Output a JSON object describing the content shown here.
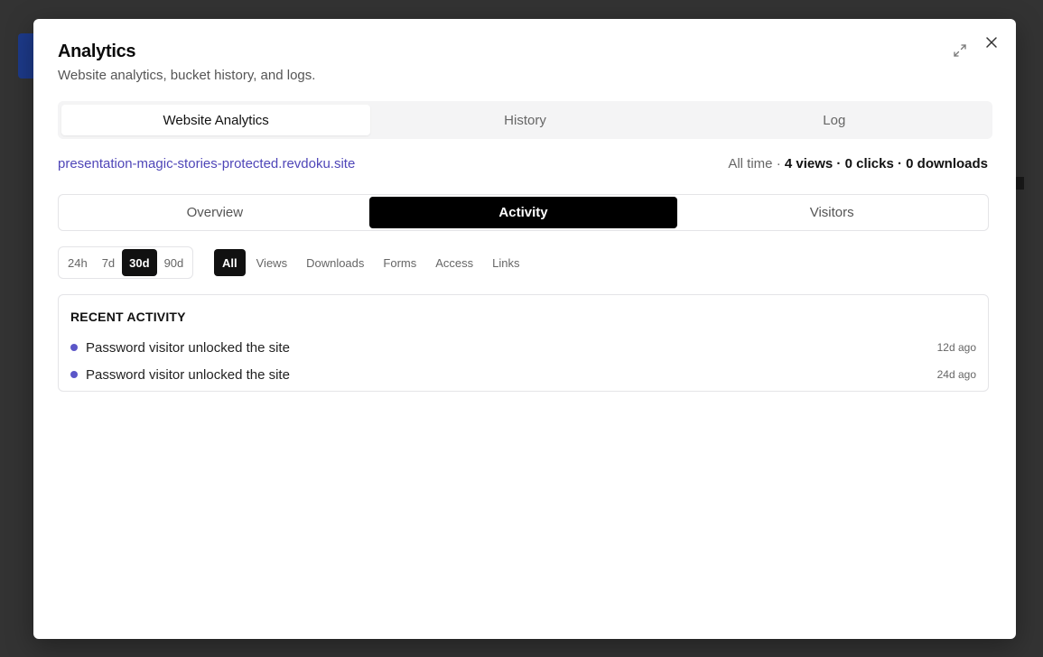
{
  "modal": {
    "title": "Analytics",
    "subtitle": "Website analytics, bucket history, and logs."
  },
  "main_tabs": [
    {
      "label": "Website Analytics",
      "active": true
    },
    {
      "label": "History",
      "active": false
    },
    {
      "label": "Log",
      "active": false
    }
  ],
  "site": {
    "url": "presentation-magic-stories-protected.revdoku.site"
  },
  "stats": {
    "period": "All time",
    "views": "4 views",
    "clicks": "0 clicks",
    "downloads": "0 downloads"
  },
  "sub_tabs": [
    {
      "label": "Overview",
      "active": false
    },
    {
      "label": "Activity",
      "active": true
    },
    {
      "label": "Visitors",
      "active": false
    }
  ],
  "ranges": [
    {
      "label": "24h",
      "active": false
    },
    {
      "label": "7d",
      "active": false
    },
    {
      "label": "30d",
      "active": true
    },
    {
      "label": "90d",
      "active": false
    }
  ],
  "filters": [
    {
      "label": "All",
      "active": true
    },
    {
      "label": "Views",
      "active": false
    },
    {
      "label": "Downloads",
      "active": false
    },
    {
      "label": "Forms",
      "active": false
    },
    {
      "label": "Access",
      "active": false
    },
    {
      "label": "Links",
      "active": false
    }
  ],
  "recent_activity": {
    "heading": "RECENT ACTIVITY",
    "items": [
      {
        "text": "Password visitor unlocked the site",
        "time": "12d ago"
      },
      {
        "text": "Password visitor unlocked the site",
        "time": "24d ago"
      }
    ]
  },
  "colors": {
    "overlay": "#333333",
    "link": "#4f46b8",
    "dot": "#5b56c8",
    "active": "#000000"
  },
  "icons": {
    "expand": "expand-icon",
    "close": "close-icon"
  }
}
